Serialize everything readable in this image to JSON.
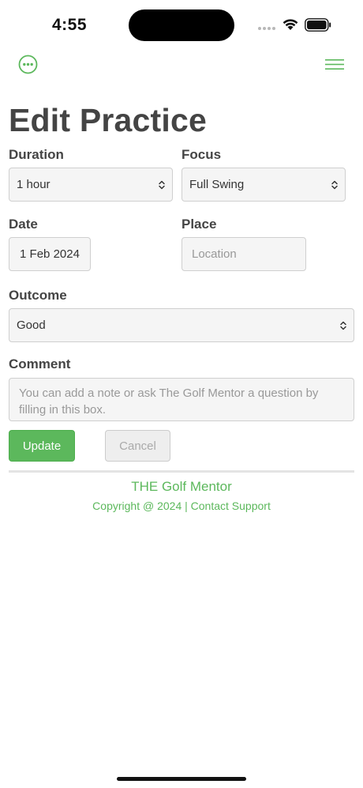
{
  "status_bar": {
    "time": "4:55"
  },
  "header": {
    "more_icon": "ellipsis-circle-icon",
    "menu_icon": "hamburger-menu-icon"
  },
  "page": {
    "title": "Edit Practice"
  },
  "form": {
    "duration": {
      "label": "Duration",
      "value": "1 hour"
    },
    "focus": {
      "label": "Focus",
      "value": "Full Swing"
    },
    "date": {
      "label": "Date",
      "value": "1 Feb 2024"
    },
    "place": {
      "label": "Place",
      "placeholder": "Location",
      "value": ""
    },
    "outcome": {
      "label": "Outcome",
      "value": "Good"
    },
    "comment": {
      "label": "Comment",
      "placeholder": "You can add a note or ask The Golf Mentor a question by filling in this box."
    },
    "update_label": "Update",
    "cancel_label": "Cancel"
  },
  "footer": {
    "brand": "THE Golf Mentor",
    "copyright": "Copyright @ 2024",
    "separator": "|",
    "contact": "Contact Support"
  },
  "colors": {
    "accent": "#5cb85c",
    "text": "#444444"
  }
}
